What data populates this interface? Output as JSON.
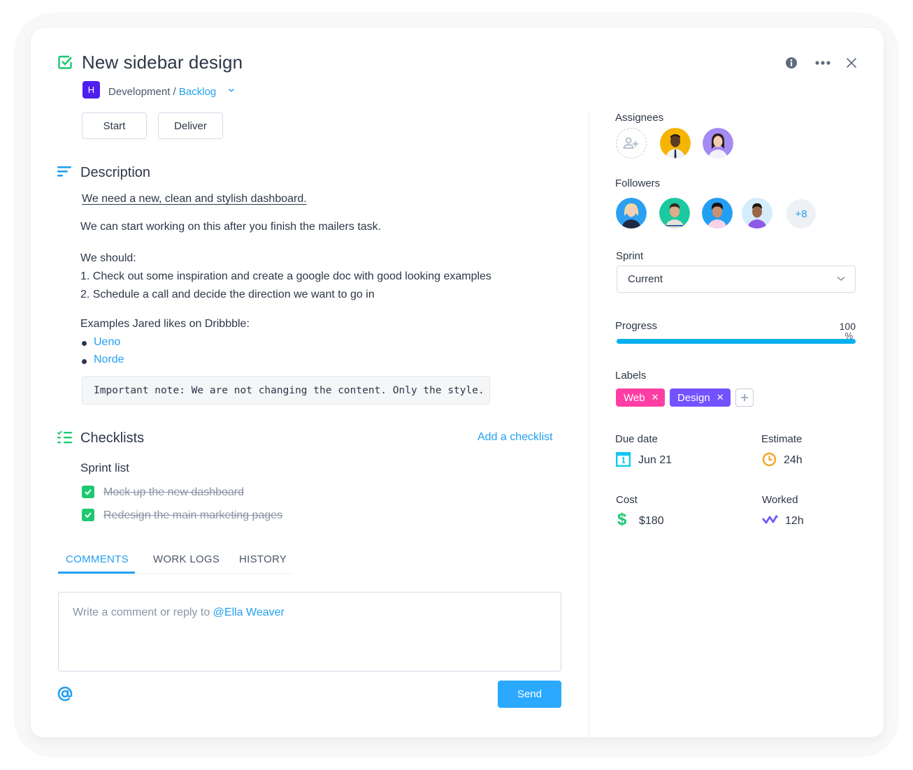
{
  "task": {
    "title": "New sidebar design",
    "project_badge": "H",
    "project": "Development / ",
    "board": "Backlog"
  },
  "header_actions": {
    "info": "info-icon",
    "more": "more-icon",
    "close": "close-icon"
  },
  "actions": {
    "start_label": "Start",
    "deliver_label": "Deliver"
  },
  "description": {
    "title": "Description",
    "lead": "We need a new, clean and stylish dashboard.",
    "para1": "We can start working on this after you finish the mailers task.",
    "should_heading": "We should:",
    "steps": [
      "1. Check out some inspiration and create a google doc with good looking examples",
      "2. Schedule a call and decide the direction we want to go in"
    ],
    "examples_heading": "Examples Jared likes on Dribbble:",
    "examples": [
      "Ueno",
      "Norde"
    ],
    "code_note": "Important note: We are not changing the content. Only the style."
  },
  "checklists": {
    "title": "Checklists",
    "add_label": "Add a checklist",
    "list_name": "Sprint list",
    "items": [
      {
        "text": "Mock up the new dashboard",
        "done": true
      },
      {
        "text": "Redesign the main marketing pages",
        "done": true
      }
    ]
  },
  "tabs": [
    {
      "label": "COMMENTS",
      "active": true
    },
    {
      "label": "WORK LOGS",
      "active": false
    },
    {
      "label": "HISTORY",
      "active": false
    }
  ],
  "comment": {
    "placeholder": "Write a comment or reply to ",
    "mention": "@Ella Weaver",
    "send_label": "Send"
  },
  "sidebar": {
    "assignees_label": "Assignees",
    "followers_label": "Followers",
    "followers_more": "+8",
    "sprint_label": "Sprint",
    "sprint_value": "Current",
    "progress_label": "Progress",
    "progress_value": "100",
    "progress_unit": "%",
    "progress_fraction": 1.0,
    "labels_label": "Labels",
    "labels": [
      {
        "name": "Web",
        "color": "#ff3ea5"
      },
      {
        "name": "Design",
        "color": "#7352ff"
      }
    ],
    "due_date_label": "Due date",
    "due_date_value": "Jun 21",
    "estimate_label": "Estimate",
    "estimate_value": "24h",
    "cost_label": "Cost",
    "cost_value": "$180",
    "worked_label": "Worked",
    "worked_value": "12h"
  },
  "colors": {
    "accent": "#23a0f0",
    "success": "#1dc872",
    "progress": "#05b0ef",
    "calendar": "#12c8f0",
    "estimate": "#f5a623",
    "worked": "#6c5cff"
  }
}
